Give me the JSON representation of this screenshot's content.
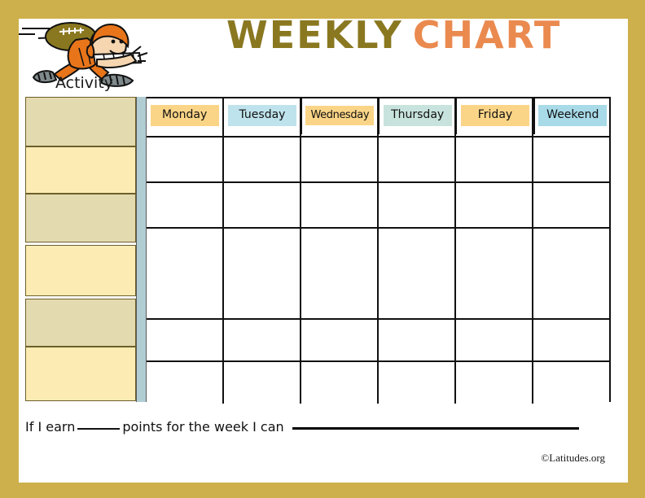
{
  "page": {
    "border_color": "#cdb04b",
    "background": "#ffffff"
  },
  "header": {
    "title_part1": "WEEKLY",
    "title_part2": "CHART",
    "title_color_1": "#8a7820",
    "title_color_2": "#ea8a4f",
    "mascot_icon": "football-player-icon",
    "activity_label": "Activity"
  },
  "table": {
    "separator_color": "#b0cdd3",
    "columns": [
      {
        "label": "Monday",
        "bg": "#fbd587"
      },
      {
        "label": "Tuesday",
        "bg": "#bfe3ec"
      },
      {
        "label": "Wednesday",
        "bg": "#fbd587"
      },
      {
        "label": "Thursday",
        "bg": "#c8e3dd"
      },
      {
        "label": "Friday",
        "bg": "#fbd587"
      },
      {
        "label": "Weekend",
        "bg": "#a8dae8"
      }
    ],
    "activity_blocks": [
      {
        "fill": "#e3daaf"
      },
      {
        "fill": "#fcecb4"
      },
      {
        "fill": "#e3daaf"
      },
      {
        "fill": "#fcecb4"
      },
      {
        "fill": "#e3daaf"
      },
      {
        "fill": "#fcecb4"
      }
    ],
    "row_count": 6,
    "cells": [
      [
        "",
        "",
        "",
        "",
        "",
        ""
      ],
      [
        "",
        "",
        "",
        "",
        "",
        ""
      ],
      [
        "",
        "",
        "",
        "",
        "",
        ""
      ],
      [
        "",
        "",
        "",
        "",
        "",
        ""
      ],
      [
        "",
        "",
        "",
        "",
        "",
        ""
      ]
    ]
  },
  "footer": {
    "text_before": "If I earn",
    "text_middle": "points for the week I can",
    "reward_blank": "",
    "points_blank": "",
    "credit": "©Latitudes.org"
  }
}
